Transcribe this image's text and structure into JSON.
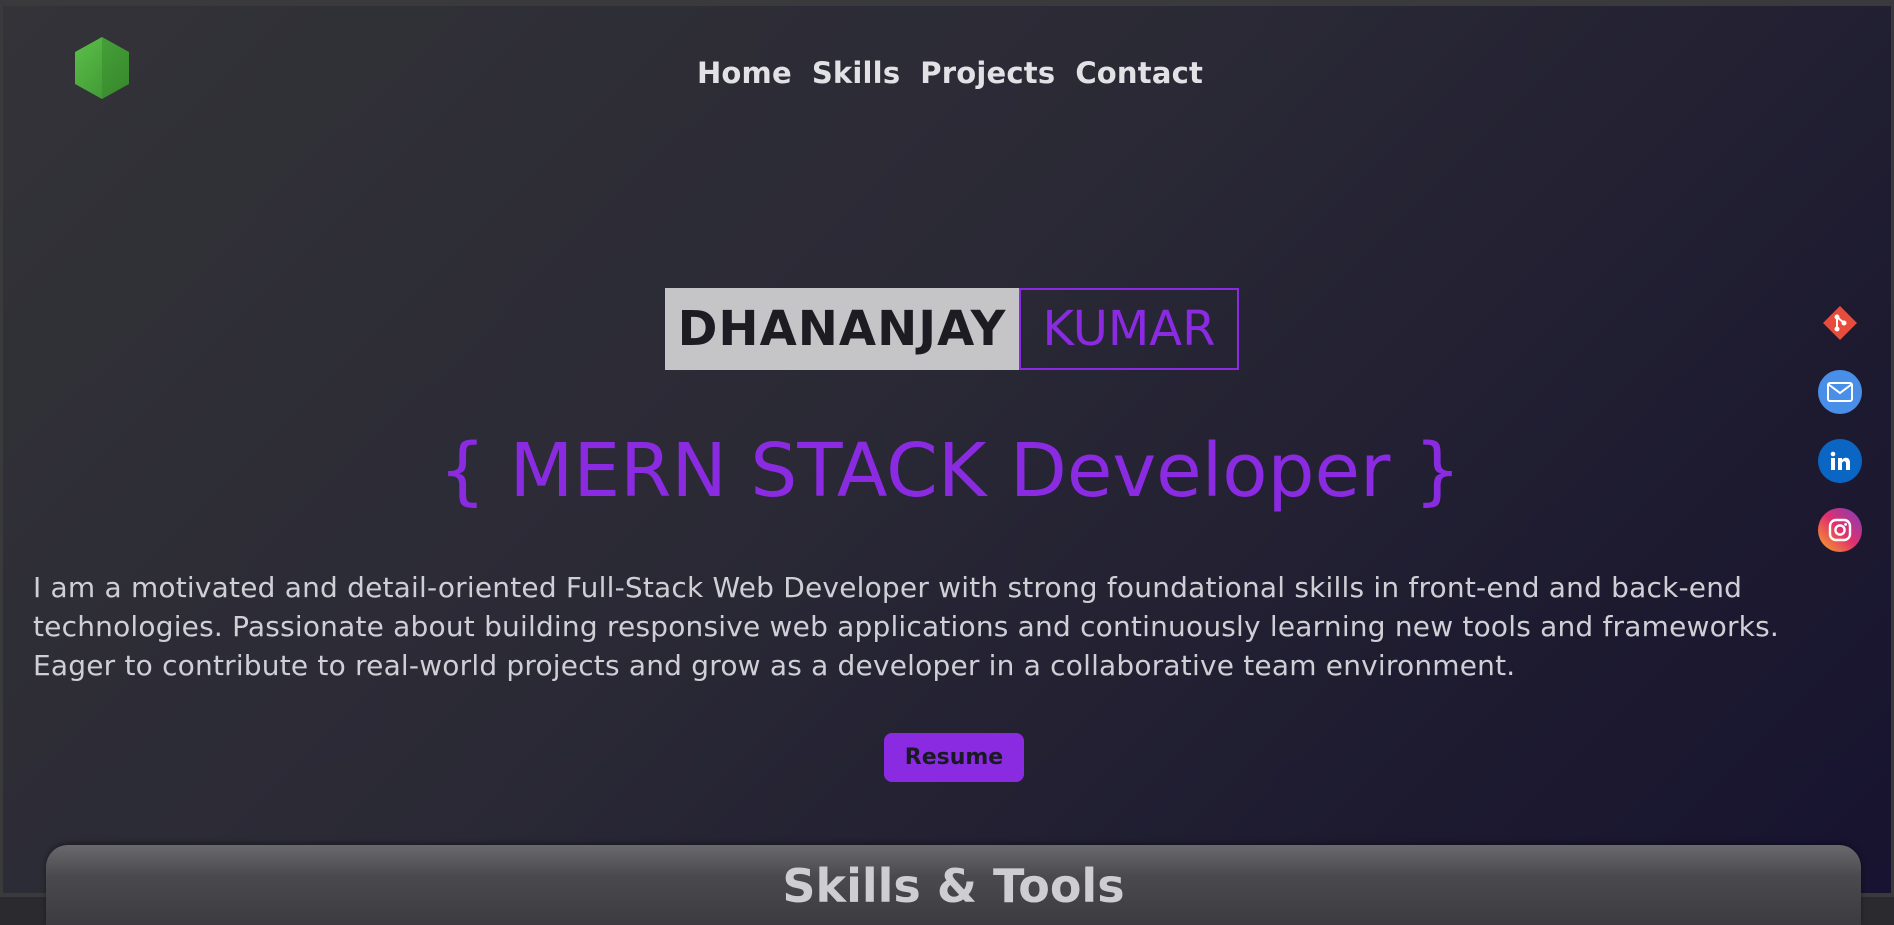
{
  "nav": {
    "items": [
      "Home",
      "Skills",
      "Projects",
      "Contact"
    ]
  },
  "hero": {
    "first_name": "DHANANJAY",
    "last_name": "KUMAR",
    "role": "{ MERN STACK Developer }",
    "bio": "I am a motivated and detail-oriented Full-Stack Web Developer with strong foundational skills in front-end and back-end technologies. Passionate about building responsive web applications and continuously learning new tools and frameworks. Eager to contribute to real-world projects and grow as a developer in a collaborative team environment.",
    "resume_label": "Resume"
  },
  "socials": [
    {
      "icon": "git-icon",
      "color": "#e74c3c"
    },
    {
      "icon": "mail-icon",
      "color": "#4a8fe7"
    },
    {
      "icon": "linkedin-icon",
      "color": "#0a66c2"
    },
    {
      "icon": "instagram-icon",
      "color": "#d6249f"
    }
  ],
  "skills": {
    "title": "Skills & Tools"
  },
  "colors": {
    "accent": "#8a2be2",
    "logo": "#4caf50"
  }
}
